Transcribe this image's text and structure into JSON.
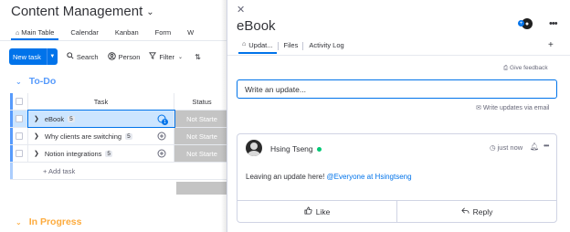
{
  "board": {
    "title": "Content Management",
    "title_chevron": "⌄",
    "tabs": [
      {
        "label": "Main Table",
        "icon": "home-icon"
      },
      {
        "label": "Calendar"
      },
      {
        "label": "Kanban"
      },
      {
        "label": "Form"
      },
      {
        "label": "W"
      }
    ],
    "toolbar": {
      "new_task": "New task",
      "search": "Search",
      "person": "Person",
      "filter": "Filter"
    },
    "groups": {
      "todo": "To-Do",
      "in_progress": "In Progress"
    },
    "table": {
      "headers": {
        "task": "Task",
        "status": "Status"
      },
      "rows": [
        {
          "name": "eBook",
          "count": "5",
          "status": "Not Starte",
          "selected": true,
          "unread_updates": "1"
        },
        {
          "name": "Why clients are switching",
          "count": "5",
          "status": "Not Starte"
        },
        {
          "name": "Notion integrations",
          "count": "5",
          "status": "Not Starte"
        }
      ],
      "add_task": "+ Add task"
    },
    "colors": {
      "todo": "#579bfc",
      "in_progress": "#fdab3d",
      "status_grey": "#c4c4c4",
      "accent": "#0073ea"
    }
  },
  "panel": {
    "title": "eBook",
    "tabs": [
      {
        "label": "Updat...",
        "icon": "home-icon"
      },
      {
        "label": "Files"
      },
      {
        "label": "Activity Log"
      }
    ],
    "add_tab": "+",
    "give_feedback": "Give feedback",
    "update_placeholder": "Write an update...",
    "write_via_email": "Write updates via email",
    "post": {
      "author": "Hsing Tseng",
      "time": "just now",
      "body_text": "Leaving an update here! ",
      "mention": "@Everyone at Hsingtseng",
      "like": "Like",
      "reply": "Reply"
    }
  }
}
